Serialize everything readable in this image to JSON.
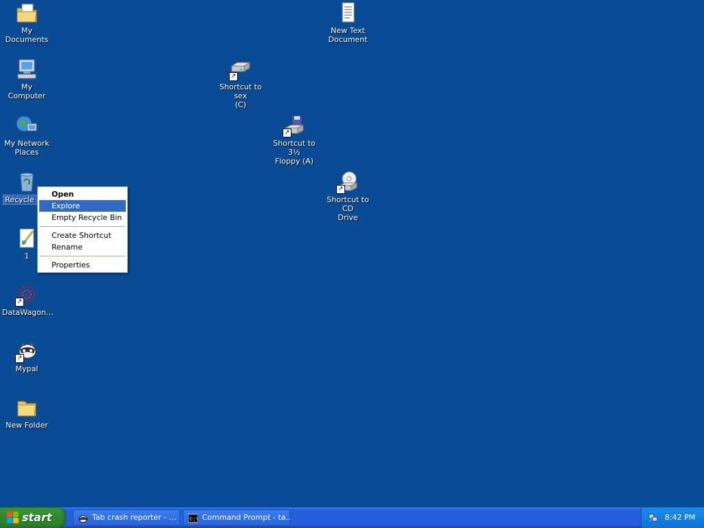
{
  "desktop": {
    "icons": [
      {
        "id": "my-documents",
        "label": "My Documents",
        "icon": "my-documents-icon"
      },
      {
        "id": "my-computer",
        "label": "My Computer",
        "icon": "my-computer-icon"
      },
      {
        "id": "my-network-places",
        "label": "My Network\nPlaces",
        "icon": "network-places-icon"
      },
      {
        "id": "recycle-bin",
        "label": "Recycle Bin",
        "icon": "recycle-bin-icon",
        "selected": true
      },
      {
        "id": "file-1",
        "label": "1",
        "icon": "paint-image-icon"
      },
      {
        "id": "datawagon",
        "label": "DataWagon…",
        "icon": "datawagon-icon",
        "shortcut": true
      },
      {
        "id": "mypal",
        "label": "Mypal",
        "icon": "mypal-raccoon-icon",
        "shortcut": true
      },
      {
        "id": "new-folder",
        "label": "New Folder",
        "icon": "folder-icon"
      },
      {
        "id": "new-text-document",
        "label": "New Text\nDocument",
        "icon": "text-document-icon"
      },
      {
        "id": "shortcut-c",
        "label": "Shortcut to sex\n(C)",
        "icon": "hard-drive-icon",
        "shortcut": true
      },
      {
        "id": "shortcut-floppy",
        "label": "Shortcut to 3½\nFloppy (A)",
        "icon": "floppy-drive-icon",
        "shortcut": true
      },
      {
        "id": "shortcut-cd",
        "label": "Shortcut to CD\nDrive",
        "icon": "cd-drive-icon",
        "shortcut": true
      }
    ]
  },
  "context_menu": {
    "items": [
      {
        "label": "Open",
        "default": true
      },
      {
        "label": "Explore",
        "highlighted": true
      },
      {
        "label": "Empty Recycle Bin"
      },
      {
        "separator": true
      },
      {
        "label": "Create Shortcut"
      },
      {
        "label": "Rename"
      },
      {
        "separator": true
      },
      {
        "label": "Properties"
      }
    ]
  },
  "taskbar": {
    "start_label": "start",
    "tasks": [
      {
        "label": "Tab crash reporter - …",
        "icon": "raccoon-icon"
      },
      {
        "label": "Command Prompt - ta…",
        "icon": "command-prompt-icon"
      }
    ],
    "clock": "8:42 PM"
  },
  "colors": {
    "desktop_bg": "#0a4b96",
    "taskbar": "#245edb",
    "start_green": "#2f8d2f",
    "selection": "#316ac5"
  }
}
